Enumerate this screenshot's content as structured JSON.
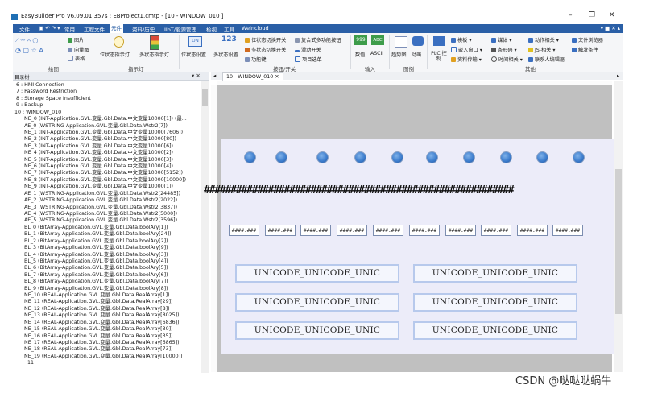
{
  "window": {
    "title": "EasyBuilder Pro V6.09.01.357s : EBProject1.cmtp - [10 - WINDOW_010 ]",
    "buttons": [
      "–",
      "❐",
      "✕"
    ]
  },
  "menubar": {
    "items": [
      "文件",
      "常用",
      "工程文件",
      "元件",
      "资料/历史",
      "IIoT/能源管理",
      "检视",
      "工具",
      "Weincloud"
    ],
    "active": "元件",
    "right": "▾ ■ ✕ ▴"
  },
  "ribbon": {
    "groups": {
      "shapes": "绘图",
      "indicator": "指示灯",
      "switch": "按钮/开关",
      "input": "输入",
      "chart": "图例",
      "other": "其他"
    },
    "labels": {
      "picture": "图片",
      "vector": "向量图",
      "table": "表格",
      "bit_lamp": "位状态指示灯",
      "multi_lamp": "多状态指示灯",
      "bit_set": "位状态设置",
      "multi_set": "多状态设置",
      "bit_toggle": "位状态切换开关",
      "multi_toggle": "多状态切换开关",
      "func_key": "功能键",
      "combo": "复合式多功能按钮",
      "slider": "滑动开关",
      "option_list": "项目选单",
      "numeric": "数值",
      "ascii": "ASCII",
      "trend": "趋势图",
      "animation": "动画",
      "plc": "PLC 控制",
      "template": "模板",
      "sub_window": "嵌入窗口",
      "data_transfer": "资料传输",
      "media": "媒体",
      "barcode": "条形码",
      "time": "时间相关",
      "action": "动作相关",
      "js": "JS-相关",
      "contact": "联系人编辑器",
      "file_browser": "文件浏览器",
      "trigger": "触发条件"
    }
  },
  "tree": {
    "title": "目录树",
    "controls": "▾ ✕",
    "items": [
      "6 : HMI Connection",
      "7 : Password Restriction",
      "8 : Storage Space Insufficient",
      "9 : Backup",
      "10 : WINDOW_010",
      "NE_0 (INT-Application.GVL.变量.Gbl.Data.中文变量10000[1]) (最...",
      "AE_0 (WSTRING-Application.GVL.变量.Gbl.Data.Wstr2[7])",
      "NE_1 (INT-Application.GVL.变量.Gbl.Data.中文变量10000[7606])",
      "NE_2 (INT-Application.GVL.变量.Gbl.Data.中文变量10000[80])",
      "NE_3 (INT-Application.GVL.变量.Gbl.Data.中文变量10000[6])",
      "NE_4 (INT-Application.GVL.变量.Gbl.Data.中文变量10000[2])",
      "NE_5 (INT-Application.GVL.变量.Gbl.Data.中文变量10000[3])",
      "NE_6 (INT-Application.GVL.变量.Gbl.Data.中文变量10000[4])",
      "NE_7 (INT-Application.GVL.变量.Gbl.Data.中文变量10000[5152])",
      "NE_8 (INT-Application.GVL.变量.Gbl.Data.中文变量10000[10000])",
      "NE_9 (INT-Application.GVL.变量.Gbl.Data.中文变量10000[1])",
      "AE_1 (WSTRING-Application.GVL.变量.Gbl.Data.Wstr2[24485])",
      "AE_2 (WSTRING-Application.GVL.变量.Gbl.Data.Wstr2[2022])",
      "AE_3 (WSTRING-Application.GVL.变量.Gbl.Data.Wstr2[3837])",
      "AE_4 (WSTRING-Application.GVL.变量.Gbl.Data.Wstr2[5000])",
      "AE_5 (WSTRING-Application.GVL.变量.Gbl.Data.Wstr2[3596])",
      "BL_0 (BitArray-Application.GVL.变量.Gbl.Data.boolAry[1])",
      "BL_1 (BitArray-Application.GVL.变量.Gbl.Data.boolAry[24])",
      "BL_2 (BitArray-Application.GVL.变量.Gbl.Data.boolAry[2])",
      "BL_3 (BitArray-Application.GVL.变量.Gbl.Data.boolAry[9])",
      "BL_4 (BitArray-Application.GVL.变量.Gbl.Data.boolAry[3])",
      "BL_5 (BitArray-Application.GVL.变量.Gbl.Data.boolAry[4])",
      "BL_6 (BitArray-Application.GVL.变量.Gbl.Data.boolAry[5])",
      "BL_7 (BitArray-Application.GVL.变量.Gbl.Data.boolAry[6])",
      "BL_8 (BitArray-Application.GVL.变量.Gbl.Data.boolAry[7])",
      "BL_9 (BitArray-Application.GVL.变量.Gbl.Data.boolAry[8])",
      "NE_10 (REAL-Application.GVL.变量.Gbl.Data.RealArray[1])",
      "NE_11 (REAL-Application.GVL.变量.Gbl.Data.RealArray[29])",
      "NE_12 (REAL-Application.GVL.变量.Gbl.Data.RealArray[8])",
      "NE_13 (REAL-Application.GVL.变量.Gbl.Data.RealArray[8025])",
      "NE_14 (REAL-Application.GVL.变量.Gbl.Data.RealArray[6836])",
      "NE_15 (REAL-Application.GVL.变量.Gbl.Data.RealArray[30])",
      "NE_16 (REAL-Application.GVL.变量.Gbl.Data.RealArray[35])",
      "NE_17 (REAL-Application.GVL.变量.Gbl.Data.RealArray[6865])",
      "NE_18 (REAL-Application.GVL.变量.Gbl.Data.RealArray[73])",
      "NE_19 (REAL-Application.GVL.变量.Gbl.Data.RealArray[10000])",
      "11"
    ]
  },
  "editor": {
    "tab": "10 - WINDOW_010",
    "tab_close": "✕",
    "hash_text": "##########################################################",
    "num_placeholder": "####.###",
    "unicode_text": "UNICODE_UNICODE_UNIC"
  },
  "watermark": "CSDN @哒哒哒蜗牛"
}
